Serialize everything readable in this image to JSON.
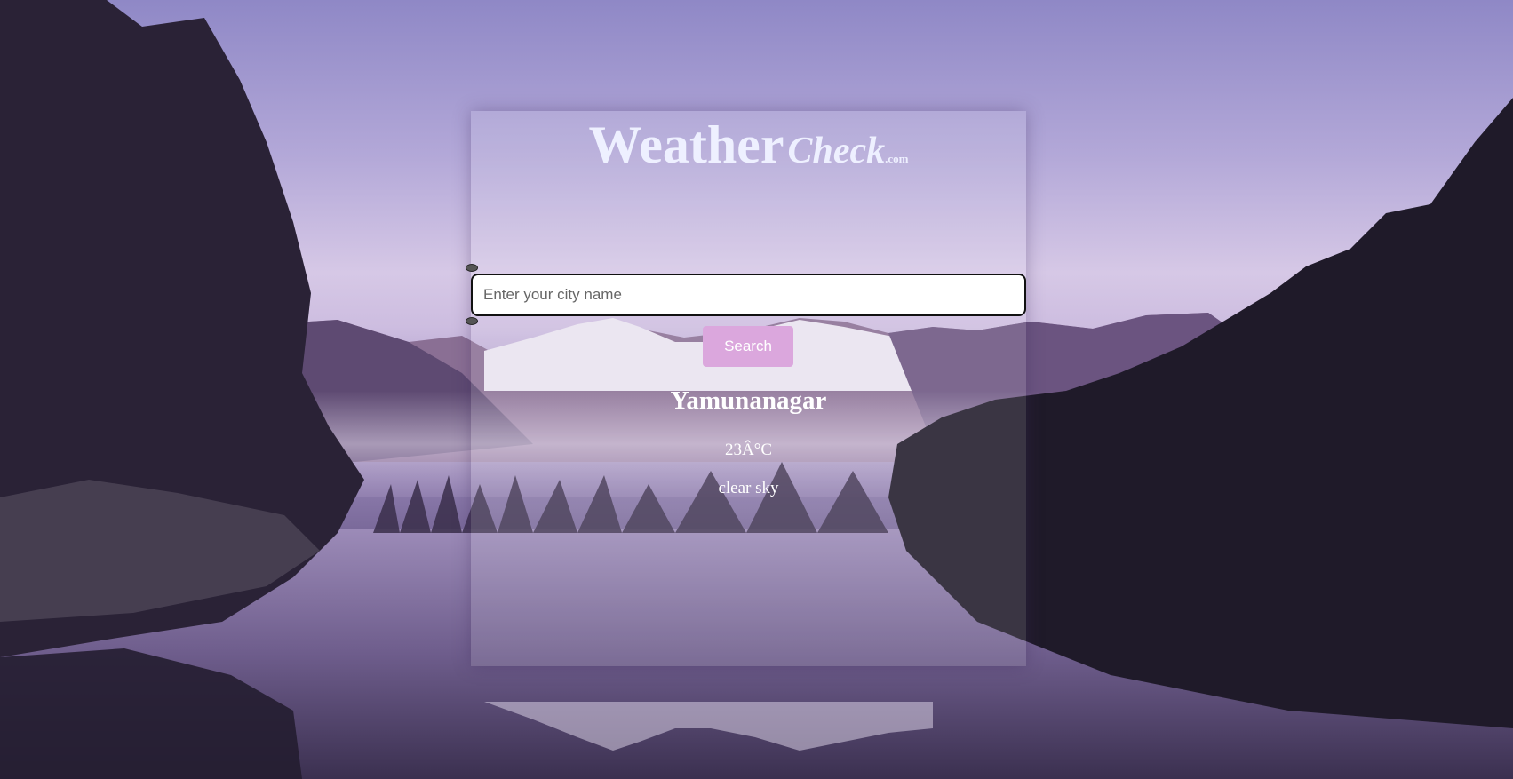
{
  "app": {
    "title_main": "Weather",
    "title_sub": "Check",
    "title_domain": ".com"
  },
  "search": {
    "placeholder": "Enter your city name",
    "value": "",
    "button_label": "Search"
  },
  "weather": {
    "city": "Yamunanagar",
    "temperature": "23Â°C",
    "description": "clear sky"
  },
  "colors": {
    "button": "#dba7dd",
    "title": "#eef0ff"
  },
  "background": {
    "subject": "mountain-lake-forest-reflection"
  }
}
